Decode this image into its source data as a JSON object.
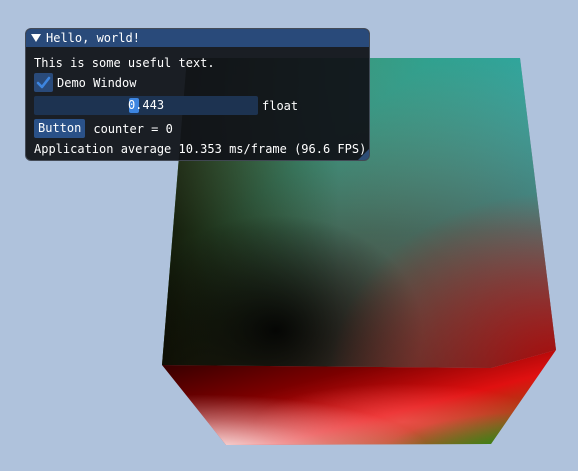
{
  "window": {
    "title": "Hello, world!",
    "body_text": "This is some useful text.",
    "checkbox_label": "Demo Window",
    "checkbox_checked": true,
    "slider_value": "0.443",
    "slider_fraction": 0.443,
    "slider_label": "float",
    "button_label": "Button",
    "counter_text": "counter = 0",
    "fps_text": "Application average 10.353 ms/frame (96.6 FPS)"
  },
  "icons": {
    "collapse": "triangle-down-icon",
    "check": "checkmark-icon",
    "resize": "resize-grip-icon"
  },
  "colors": {
    "clear_color": "#afc2dc",
    "title_bar": "#294a7a",
    "window_bg": "#111318",
    "frame_bg": "#1d3351",
    "accent": "#3d85e0",
    "button": "#2a5188"
  }
}
